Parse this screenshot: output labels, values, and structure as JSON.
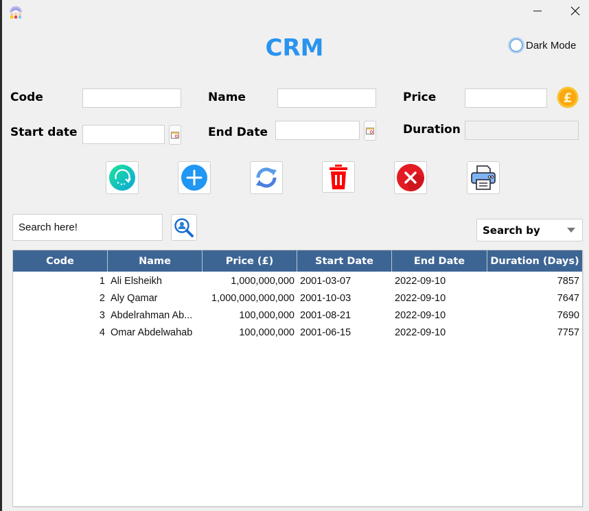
{
  "window": {
    "title": "CRM",
    "minimize_icon": "minimize-icon",
    "close_icon": "close-icon",
    "app_icon": "team-rainbow-icon"
  },
  "dark_mode": {
    "label": "Dark Mode",
    "checked": false
  },
  "form": {
    "code": {
      "label": "Code",
      "value": ""
    },
    "name": {
      "label": "Name",
      "value": ""
    },
    "price": {
      "label": "Price",
      "value": "",
      "icon": "pound-coin-icon"
    },
    "start_date": {
      "label": "Start date",
      "value": "",
      "icon": "calendar-icon"
    },
    "end_date": {
      "label": "End Date",
      "value": "",
      "icon": "calendar-icon"
    },
    "duration": {
      "label": "Duration",
      "value": "",
      "disabled": true
    }
  },
  "toolbar": [
    {
      "name": "reload-button",
      "icon": "circular-arrow-icon"
    },
    {
      "name": "add-button",
      "icon": "plus-icon"
    },
    {
      "name": "update-button",
      "icon": "sync-icon"
    },
    {
      "name": "delete-button",
      "icon": "trash-icon"
    },
    {
      "name": "clear-button",
      "icon": "x-circle-icon"
    },
    {
      "name": "print-button",
      "icon": "printer-icon"
    }
  ],
  "search": {
    "placeholder": "Search here!",
    "value": "Search here!",
    "button_icon": "user-search-icon",
    "search_by": {
      "selected": "Search by"
    }
  },
  "table": {
    "columns": [
      "Code",
      "Name",
      "Price (£)",
      "Start Date",
      "End Date",
      "Duration (Days)"
    ],
    "rows": [
      [
        "1",
        "Ali Elsheikh",
        "1,000,000,000",
        "2001-03-07",
        "2022-09-10",
        "7857"
      ],
      [
        "2",
        "Aly Qamar",
        "1,000,000,000,000",
        "2001-10-03",
        "2022-09-10",
        "7647"
      ],
      [
        "3",
        "Abdelrahman Ab...",
        "100,000,000",
        "2001-08-21",
        "2022-09-10",
        "7690"
      ],
      [
        "4",
        "Omar Abdelwahab",
        "100,000,000",
        "2001-06-15",
        "2022-09-10",
        "7757"
      ]
    ]
  }
}
